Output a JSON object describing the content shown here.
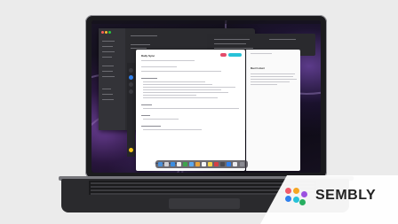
{
  "doc": {
    "title": "Daily Sync"
  },
  "panel": {
    "title": "Meet Content"
  },
  "brand": {
    "name": "SEMBLY",
    "logo_colors": [
      "#f25a6b",
      "#f5a623",
      "#2f80ed",
      "#27ae60",
      "#9b51e0",
      "#27c2d8"
    ]
  },
  "icons": [
    "laptop-icon",
    "sembly-logo-icon"
  ]
}
